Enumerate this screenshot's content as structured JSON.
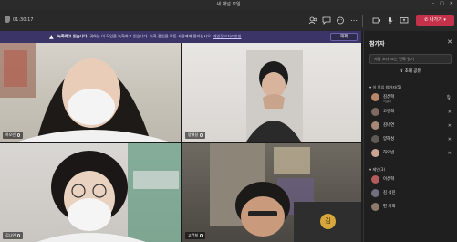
{
  "window": {
    "title": "새 채널 모임"
  },
  "toolbar": {
    "timer": "01:30:17",
    "leave_label": "나가기"
  },
  "banner": {
    "bold": "녹화하고 있습니다.",
    "message": " 귀하는 이 모임을 녹화하고 있습니다. 녹화 중임을 모든 사람에게 알리십시오. ",
    "link": "개인정보처리방침",
    "dismiss_label": "해제"
  },
  "tiles": [
    {
      "name": "하오빈"
    },
    {
      "name": "양해성"
    },
    {
      "name": "김나연"
    },
    {
      "name": "고건희"
    }
  ],
  "self_avatar": "김",
  "panel": {
    "title": "참가자",
    "search_placeholder": "사람 초대 또는 전화 걸기",
    "share_label": "초대 공유",
    "section1": "이 모임 참가자(5)",
    "section2": "제안(3)",
    "participants": [
      {
        "name": "김상혁",
        "sub": "이끌이"
      },
      {
        "name": "고건희",
        "sub": ""
      },
      {
        "name": "김나연",
        "sub": ""
      },
      {
        "name": "양해성",
        "sub": ""
      },
      {
        "name": "하오빈",
        "sub": ""
      }
    ],
    "suggestions": [
      {
        "name": "이상혁"
      },
      {
        "name": "김 석진"
      },
      {
        "name": "편 지희"
      }
    ]
  },
  "colors": {
    "accent": "#6264a7",
    "leave": "#c4314b",
    "banner": "#3b3467"
  }
}
